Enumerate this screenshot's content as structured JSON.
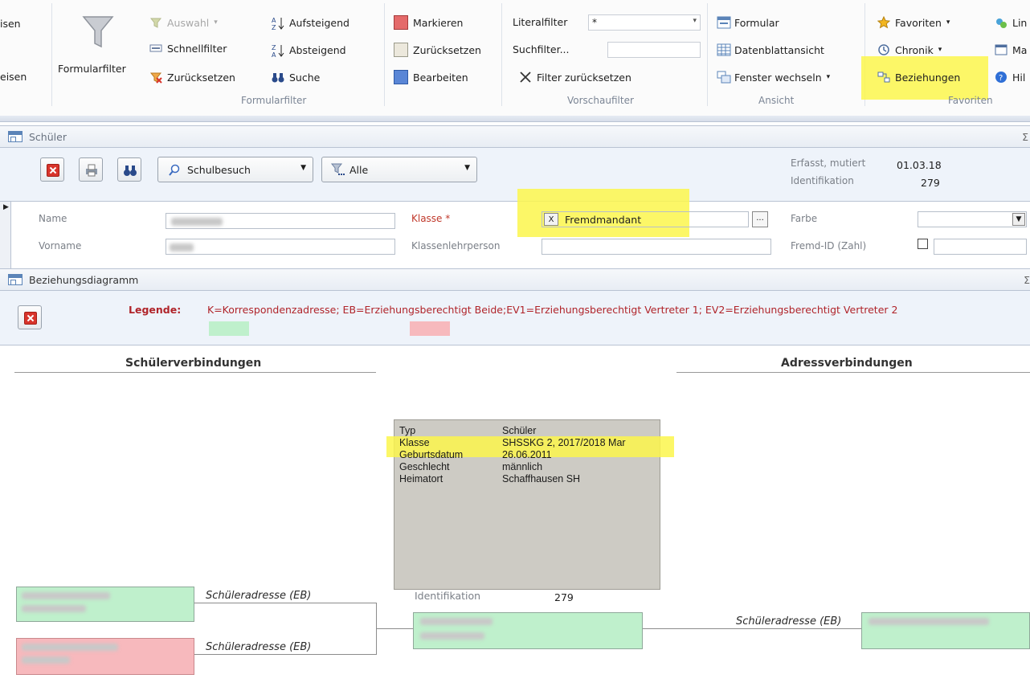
{
  "ribbon": {
    "cut_left_top": "isen",
    "cut_left_bottom": "eisen",
    "formularfilter_label": "Formularfilter",
    "auswahl_label": "Auswahl",
    "schnellfilter_label": "Schnellfilter",
    "zuruecksetzen_label": "Zurücksetzen",
    "aufsteigend_label": "Aufsteigend",
    "absteigend_label": "Absteigend",
    "suche_label": "Suche",
    "group_formularfilter": "Formularfilter",
    "markieren_label": "Markieren",
    "zuruecksetzen2_label": "Zurücksetzen",
    "bearbeiten_label": "Bearbeiten",
    "literalfilter_label": "Literalfilter",
    "literalfilter_value": "*",
    "suchfilter_label": "Suchfilter...",
    "filter_zuruecksetzen_label": "Filter zurücksetzen",
    "group_vorschaufilter": "Vorschaufilter",
    "formular_label": "Formular",
    "datenblattansicht_label": "Datenblattansicht",
    "fenster_wechseln_label": "Fenster wechseln",
    "group_ansicht": "Ansicht",
    "favoriten_label": "Favoriten",
    "chronik_label": "Chronik",
    "beziehungen_label": "Beziehungen",
    "group_favoriten": "Favoriten",
    "cut_right_1": "Lin",
    "cut_right_2": "Ma",
    "cut_right_3": "Hil"
  },
  "schueler_form": {
    "title": "Schüler",
    "filter_dropdown_value": "Schulbesuch",
    "scope_dropdown_value": "Alle",
    "erfasst_label": "Erfasst, mutiert",
    "erfasst_value": "01.03.18",
    "identifikation_label": "Identifikation",
    "identifikation_value": "279",
    "name_label": "Name",
    "vorname_label": "Vorname",
    "klasse_label": "Klasse *",
    "klasse_x": "X",
    "klasse_value": "Fremdmandant",
    "klasse_ellipsis": "...",
    "klassenlehrperson_label": "Klassenlehrperson",
    "farbe_label": "Farbe",
    "fremd_id_label": "Fremd-ID (Zahl)"
  },
  "diagram": {
    "title": "Beziehungsdiagramm",
    "legend_label": "Legende:",
    "legend_text": "K=Korrespondenzadresse; EB=Erziehungsberechtigt Beide;EV1=Erziehungsberechtigt Vertreter 1; EV2=Erziehungsberechtigt Vertreter 2",
    "col_left": "Schülerverbindungen",
    "col_right": "Adressverbindungen",
    "info_rows": [
      {
        "key": "Typ",
        "value": "Schüler"
      },
      {
        "key": "Klasse",
        "value": "SHSSKG 2, 2017/2018 Mar"
      },
      {
        "key": "Geburtsdatum",
        "value": "26.06.2011"
      },
      {
        "key": "Geschlecht",
        "value": "männlich"
      },
      {
        "key": "Heimatort",
        "value": "Schaffhausen SH"
      }
    ],
    "edge_label_1": "Schüleradresse (EB)",
    "edge_label_2": "Schüleradresse (EB)",
    "edge_label_3": "Schüleradresse (EB)",
    "center_ident_label": "Identifikation",
    "center_ident_value": "279"
  },
  "colors": {
    "highlight": "#fbf64c",
    "node_green": "#bff0cc",
    "node_red": "#f7b9bd",
    "legend_text": "#b0242a"
  }
}
